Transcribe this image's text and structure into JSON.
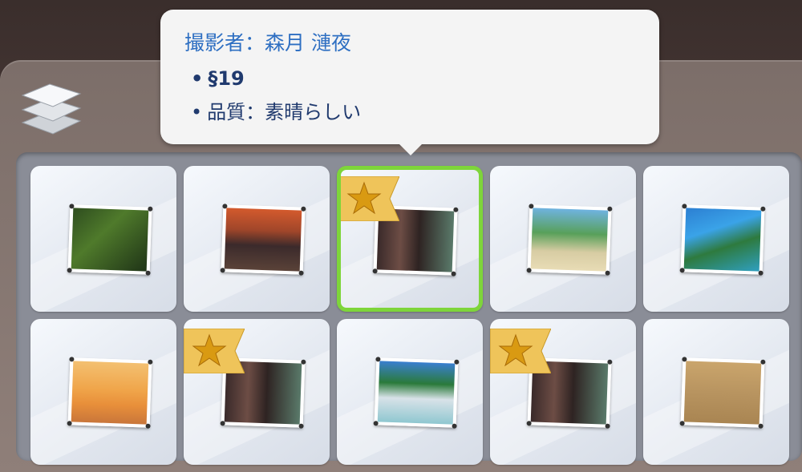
{
  "tooltip": {
    "title": "撮影者：森月 漣夜",
    "price_symbol": "§",
    "price_value": "19",
    "quality": "品質：素晴らしい",
    "bullet": "•"
  },
  "header": {
    "stack_icon": "layers-icon"
  },
  "photos": [
    {
      "row": 1,
      "col": 1,
      "scene": "jungle-foliage",
      "starred": false,
      "selected": false
    },
    {
      "row": 1,
      "col": 2,
      "scene": "sunset-terrace",
      "starred": false,
      "selected": false
    },
    {
      "row": 1,
      "col": 3,
      "scene": "couple-portrait",
      "starred": true,
      "selected": true
    },
    {
      "row": 1,
      "col": 4,
      "scene": "beach-swing",
      "starred": false,
      "selected": false
    },
    {
      "row": 1,
      "col": 5,
      "scene": "tropical-cove",
      "starred": false,
      "selected": false
    },
    {
      "row": 2,
      "col": 1,
      "scene": "orange-sunset-sea",
      "starred": false,
      "selected": false
    },
    {
      "row": 2,
      "col": 2,
      "scene": "couple-portrait",
      "starred": true,
      "selected": false
    },
    {
      "row": 2,
      "col": 3,
      "scene": "palm-beach-house",
      "starred": false,
      "selected": false
    },
    {
      "row": 2,
      "col": 4,
      "scene": "couple-portrait",
      "starred": true,
      "selected": false
    },
    {
      "row": 2,
      "col": 5,
      "scene": "sandy-rocks",
      "starred": false,
      "selected": false
    }
  ],
  "colors": {
    "selected_border": "#7ed53a",
    "tooltip_title": "#2e6fc2",
    "star_gold": "#e5b330"
  }
}
